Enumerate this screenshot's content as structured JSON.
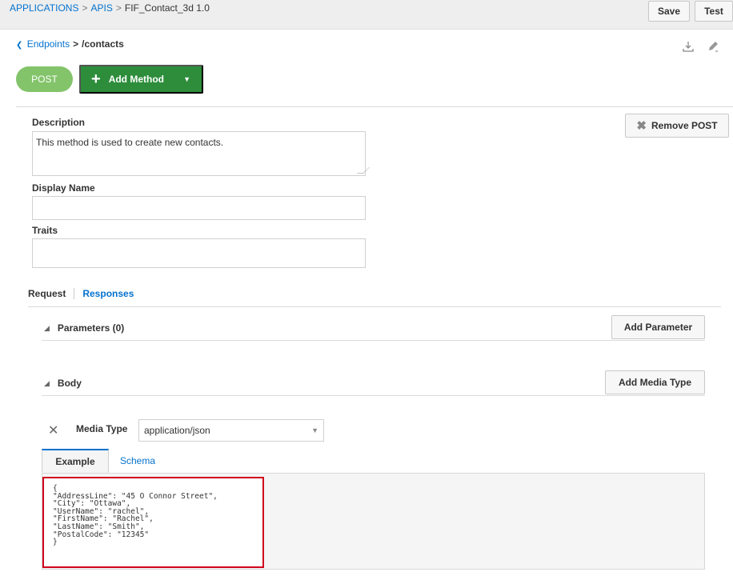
{
  "breadcrumb": {
    "applications": "APPLICATIONS",
    "apis": "APIS",
    "current": "FIF_Contact_3d  1.0",
    "separator": ">"
  },
  "toolbar": {
    "save_label": "Save",
    "test_label": "Test"
  },
  "endpoint_nav": {
    "back_label": "Endpoints",
    "separator": ">",
    "path": "/contacts"
  },
  "icons": {
    "download": "download-icon",
    "edit": "edit-icon"
  },
  "method": {
    "badge": "POST",
    "add_method_label": "Add Method"
  },
  "form": {
    "description_label": "Description",
    "description_value": "This method is used to create new contacts.",
    "display_name_label": "Display Name",
    "display_name_value": "",
    "traits_label": "Traits",
    "traits_value": "",
    "remove_label": "Remove POST"
  },
  "tabs": {
    "request": "Request",
    "responses": "Responses"
  },
  "sections": {
    "parameters_title": "Parameters (0)",
    "add_parameter_label": "Add Parameter",
    "body_title": "Body",
    "add_media_type_label": "Add Media Type"
  },
  "media": {
    "label": "Media Type",
    "selected": "application/json"
  },
  "example_tabs": {
    "example": "Example",
    "schema": "Schema"
  },
  "example_body": "{\n\"AddressLine\": \"45 O Connor Street\",\n\"City\": \"Ottawa\",\n\"UserName\": \"rachel\",\n\"FirstName\": \"Rachel\",\n\"LastName\": \"Smith\",\n\"PostalCode\": \"12345\"\n}",
  "colors": {
    "link": "#0572ce",
    "post_badge": "#83c46a",
    "add_method": "#2d8d3b",
    "highlight_border": "#d0021b"
  }
}
